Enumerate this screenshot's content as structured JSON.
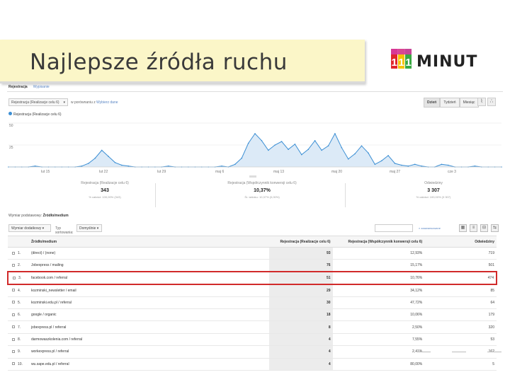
{
  "slide": {
    "title": "Najlepsze źródła ruchu",
    "logo": {
      "digits": [
        "1",
        "1",
        "1"
      ],
      "digit_colors": [
        "#e0262b",
        "#f5c400",
        "#3aa843"
      ],
      "word": "MINUT"
    }
  },
  "toolbar": {
    "tabs": [
      "Rejestracja",
      "Wypisanie"
    ],
    "metric_select": "Rejestracja (Realizacje celu 6)",
    "vs_label": "w porównaniu z",
    "pick_metric": "Wybierz dane",
    "period": [
      "Dzień",
      "Tydzień",
      "Miesiąc"
    ],
    "icons": [
      "line-chart-icon",
      "motion-chart-icon"
    ]
  },
  "chart": {
    "legend": "Rejestracja (Realizacje celu 6)",
    "y_ticks": [
      "50",
      "25"
    ],
    "x_ticks": [
      "lut 15",
      "lut 22",
      "lut 29",
      "maj 6",
      "maj 13",
      "maj 20",
      "maj 27",
      "cze 3"
    ],
    "accent": "#3c8fd4",
    "fill": "#dceaf7"
  },
  "chart_data": {
    "type": "area",
    "title": "",
    "series": [
      {
        "name": "Rejestracja (Realizacje celu 6)",
        "values": [
          0,
          0,
          0,
          0,
          1,
          0,
          0,
          0,
          0,
          0,
          0,
          1,
          4,
          10,
          19,
          12,
          5,
          2,
          1,
          0,
          0,
          0,
          0,
          0,
          1,
          0,
          0,
          0,
          0,
          0,
          0,
          0,
          1,
          0,
          3,
          10,
          27,
          38,
          30,
          19,
          25,
          29,
          20,
          26,
          14,
          20,
          30,
          19,
          24,
          38,
          22,
          9,
          15,
          24,
          16,
          3,
          7,
          13,
          4,
          2,
          1,
          3,
          1,
          0,
          0,
          3,
          2,
          0,
          0,
          0,
          1,
          0,
          0,
          0,
          0
        ]
      }
    ],
    "y_ticks": [
      50,
      25
    ],
    "ylim": [
      0,
      50
    ],
    "x_tick_labels": [
      "lut 15",
      "lut 22",
      "lut 29",
      "maj 6",
      "maj 13",
      "maj 20",
      "maj 27",
      "cze 3"
    ],
    "grid": true
  },
  "summary": [
    {
      "label": "Rejestracja (Realizacje celu 6)",
      "value": "343",
      "sub": "% całości: 100,00% (343)"
    },
    {
      "label": "Rejestracja (Współczynnik konwersji celu 6)",
      "value": "10,37%",
      "sub": "Śr. widoku: 10,37% (0,00%)"
    },
    {
      "label": "Odwiedziny",
      "value": "3 307",
      "sub": "% całości: 100,00% (3 307)"
    }
  ],
  "table_controls": {
    "primary_label": "Wymiar podstawowy:",
    "primary_value": "Źródło/medium",
    "secondary": "Wymiar dodatkowy",
    "sort_label": "Typ sortowania:",
    "sort_value": "Domyślnie",
    "search_label": "zaawansowane"
  },
  "table": {
    "headers": [
      "Źródło/medium",
      "Rejestracja (Realizacje celu 6)",
      "Rejestracja (Współczynnik konwersji celu 6)",
      "Odwiedziny"
    ],
    "rows": [
      {
        "idx": "1.",
        "source": "(direct) / (none)",
        "goals": "93",
        "rate": "12,93%",
        "visits": "719"
      },
      {
        "idx": "2.",
        "source": "Jobexpress / mailing",
        "goals": "76",
        "rate": "15,17%",
        "visits": "501"
      },
      {
        "idx": "3.",
        "source": "facebook.com / referral",
        "goals": "51",
        "rate": "10,76%",
        "visits": "474"
      },
      {
        "idx": "4.",
        "source": "kozminski_newsletter / email",
        "goals": "29",
        "rate": "34,12%",
        "visits": "85"
      },
      {
        "idx": "5.",
        "source": "kozminski.edu.pl / referral",
        "goals": "30",
        "rate": "47,72%",
        "visits": "64"
      },
      {
        "idx": "6.",
        "source": "google / organic",
        "goals": "18",
        "rate": "10,06%",
        "visits": "179"
      },
      {
        "idx": "7.",
        "source": "jobexpress.pl / referral",
        "goals": "8",
        "rate": "2,50%",
        "visits": "320"
      },
      {
        "idx": "8.",
        "source": "darmowaszkolenia.com / referral",
        "goals": "4",
        "rate": "7,55%",
        "visits": "53"
      },
      {
        "idx": "9.",
        "source": "workexpress.pl / referral",
        "goals": "4",
        "rate": "2,41%",
        "visits": "162"
      },
      {
        "idx": "10.",
        "source": "wu.sape.edu.pl / referral",
        "goals": "4",
        "rate": "80,00%",
        "visits": "5"
      }
    ],
    "highlight_color": "#d12a2a"
  }
}
